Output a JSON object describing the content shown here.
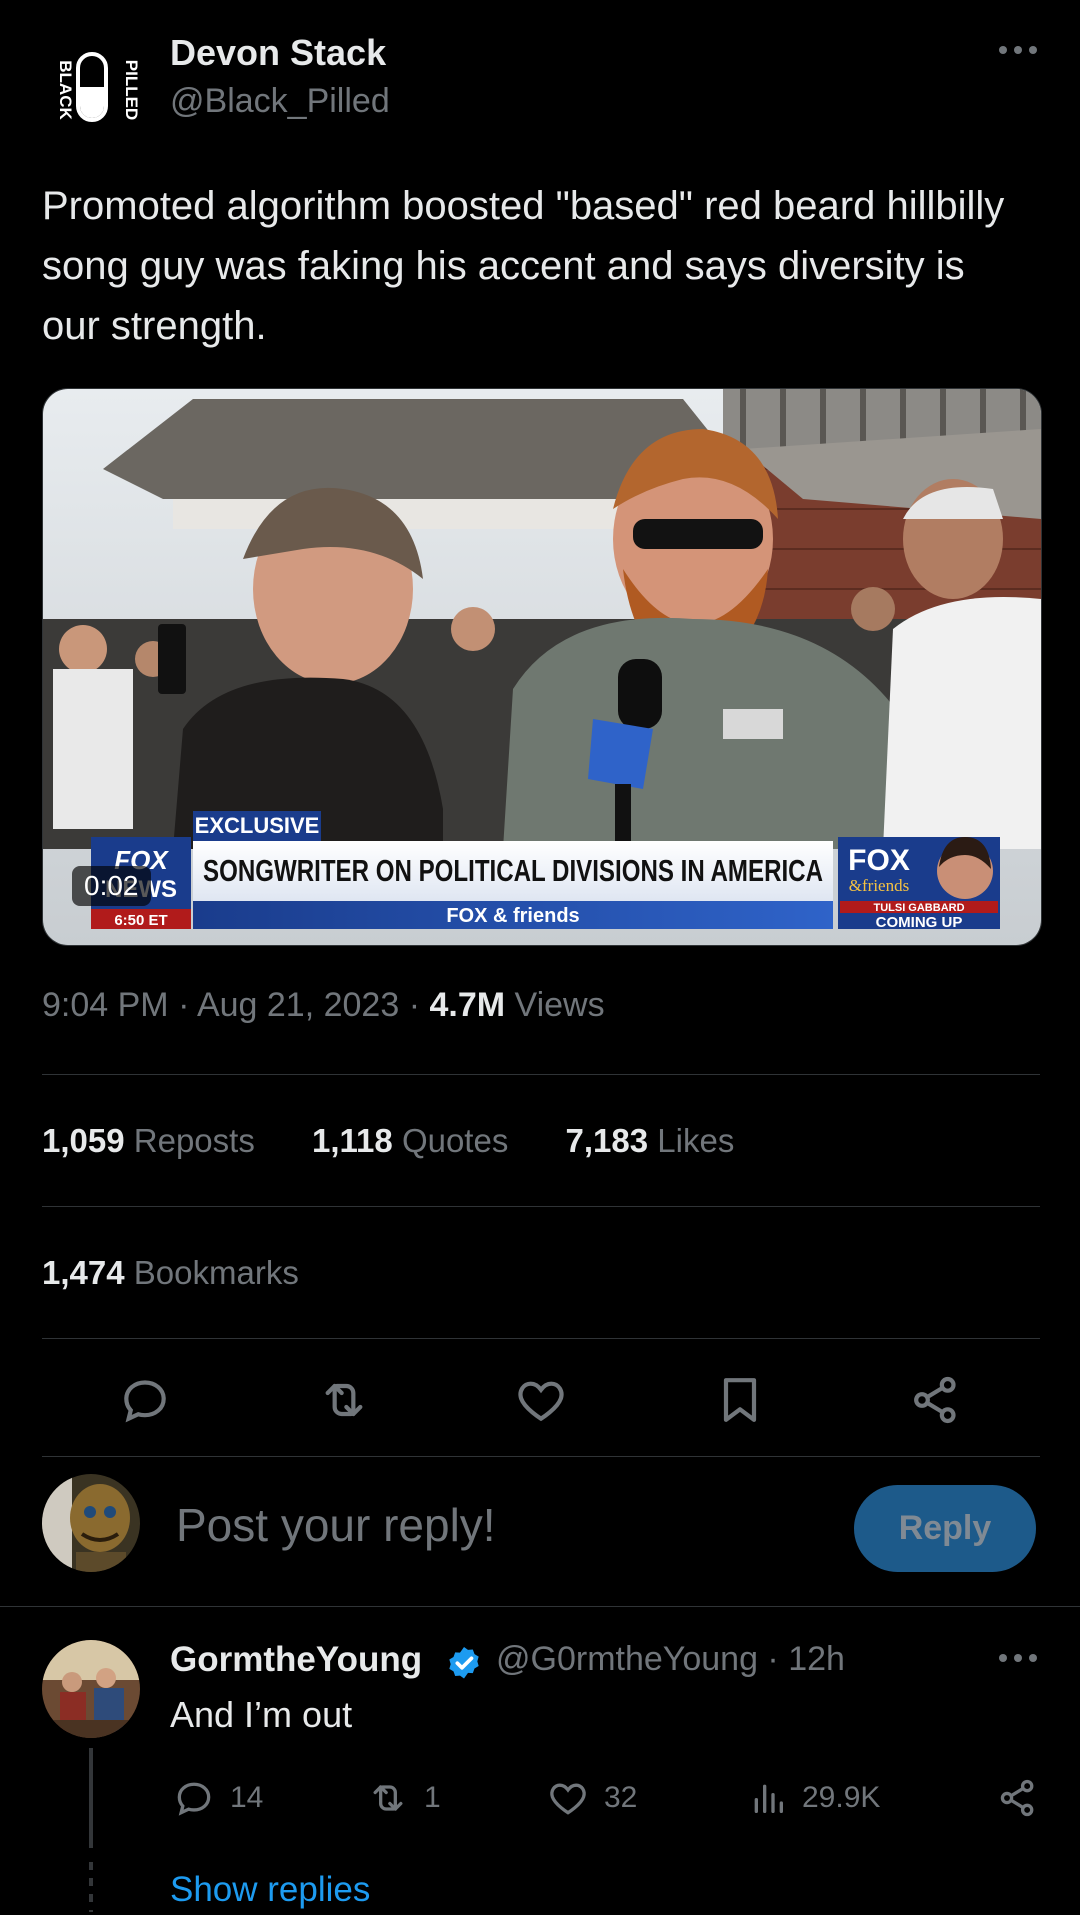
{
  "post": {
    "author": {
      "display_name": "Devon Stack",
      "handle": "@Black_Pilled",
      "avatar_text_left": "BLACK",
      "avatar_text_right": "PILLED"
    },
    "text": "Promoted algorithm boosted \"based\" red beard hillbilly song guy was faking his accent and says diversity is our strength.",
    "video": {
      "duration": "0:02",
      "chyron_tag": "EXCLUSIVE",
      "chyron_headline": "SONGWRITER ON POLITICAL DIVISIONS IN AMERICA",
      "chyron_show": "FOX & friends",
      "network_logo_line1": "FOX",
      "network_logo_line2": "NEWS",
      "network_time": "6:50 ET",
      "promo_logo": "FOX",
      "promo_logo_sub": "&friends",
      "promo_name": "TULSI GABBARD",
      "promo_coming": "COMING UP"
    },
    "timestamp": "9:04 PM · Aug 21, 2023 ·",
    "views_count": "4.7M",
    "views_label": "Views",
    "stats": {
      "reposts_count": "1,059",
      "reposts_label": "Reposts",
      "quotes_count": "1,118",
      "quotes_label": "Quotes",
      "likes_count": "7,183",
      "likes_label": "Likes",
      "bookmarks_count": "1,474",
      "bookmarks_label": "Bookmarks"
    },
    "actions": [
      "reply-icon",
      "repost-icon",
      "like-icon",
      "bookmark-icon",
      "share-icon"
    ]
  },
  "composer": {
    "placeholder": "Post your reply!",
    "reply_button": "Reply"
  },
  "comment": {
    "display_name": "GormtheYoung",
    "handle_time": "@G0rmtheYoung · 12h",
    "text": "And I’m out",
    "replies": "14",
    "reposts": "1",
    "likes": "32",
    "views": "29.9K",
    "show_replies": "Show replies"
  },
  "colors": {
    "background": "#000000",
    "text": "#e7e9ea",
    "muted": "#71767b",
    "accent": "#1d9bf0",
    "reply_button": "#1d5a8a",
    "divider": "#2f3336"
  }
}
